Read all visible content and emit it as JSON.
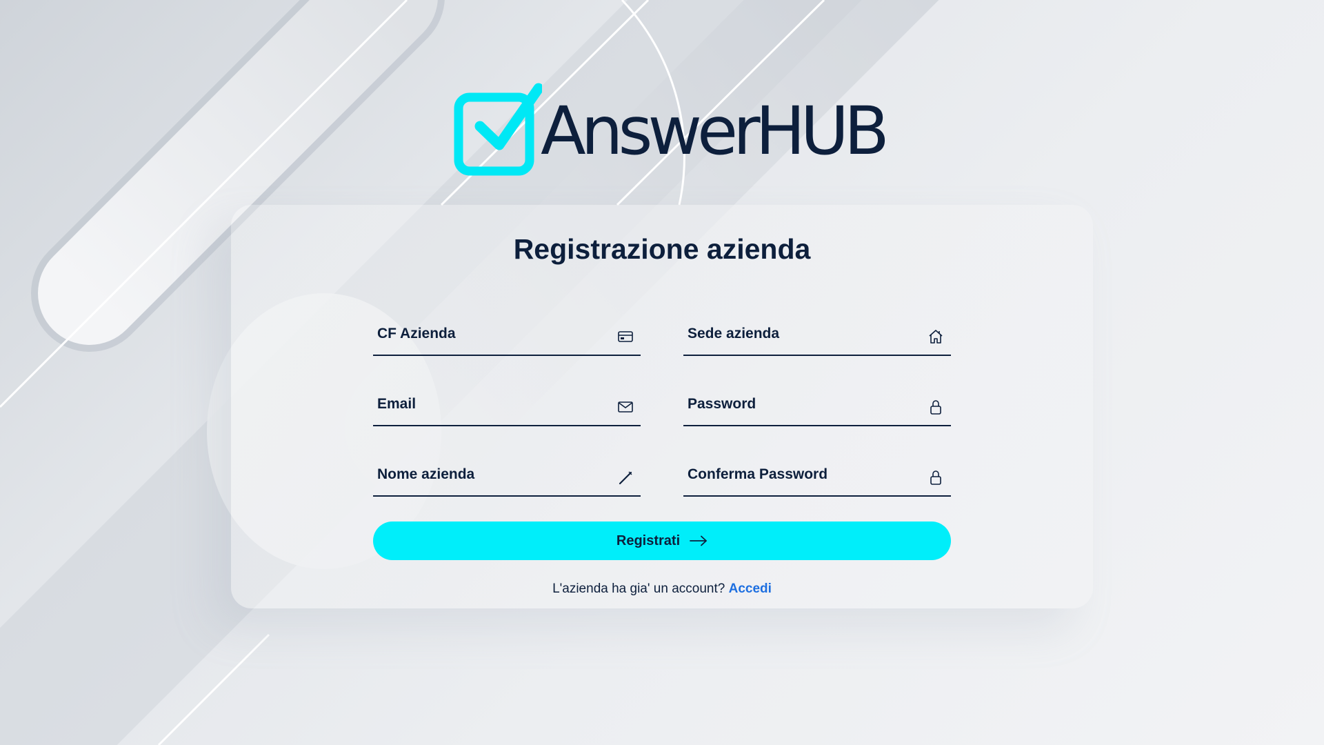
{
  "brand": {
    "name": "AnswerHUB",
    "accent_color": "#00eefa",
    "text_color": "#0d1f3c"
  },
  "form": {
    "title": "Registrazione azienda",
    "fields": {
      "cf_azienda": {
        "placeholder": "CF Azienda",
        "value": "",
        "icon": "credit-card-icon"
      },
      "sede_azienda": {
        "placeholder": "Sede azienda",
        "value": "",
        "icon": "home-icon"
      },
      "email": {
        "placeholder": "Email",
        "value": "",
        "icon": "mail-icon"
      },
      "password": {
        "placeholder": "Password",
        "value": "",
        "icon": "lock-icon"
      },
      "nome_azienda": {
        "placeholder": "Nome azienda",
        "value": "",
        "icon": "pencil-icon"
      },
      "conferma_password": {
        "placeholder": "Conferma Password",
        "value": "",
        "icon": "lock-icon"
      }
    },
    "submit_label": "Registrati",
    "submit_icon": "arrow-right-icon"
  },
  "footer": {
    "prompt": "L'azienda ha gia' un account?",
    "link_label": "Accedi",
    "link_color": "#1e6fe0"
  }
}
